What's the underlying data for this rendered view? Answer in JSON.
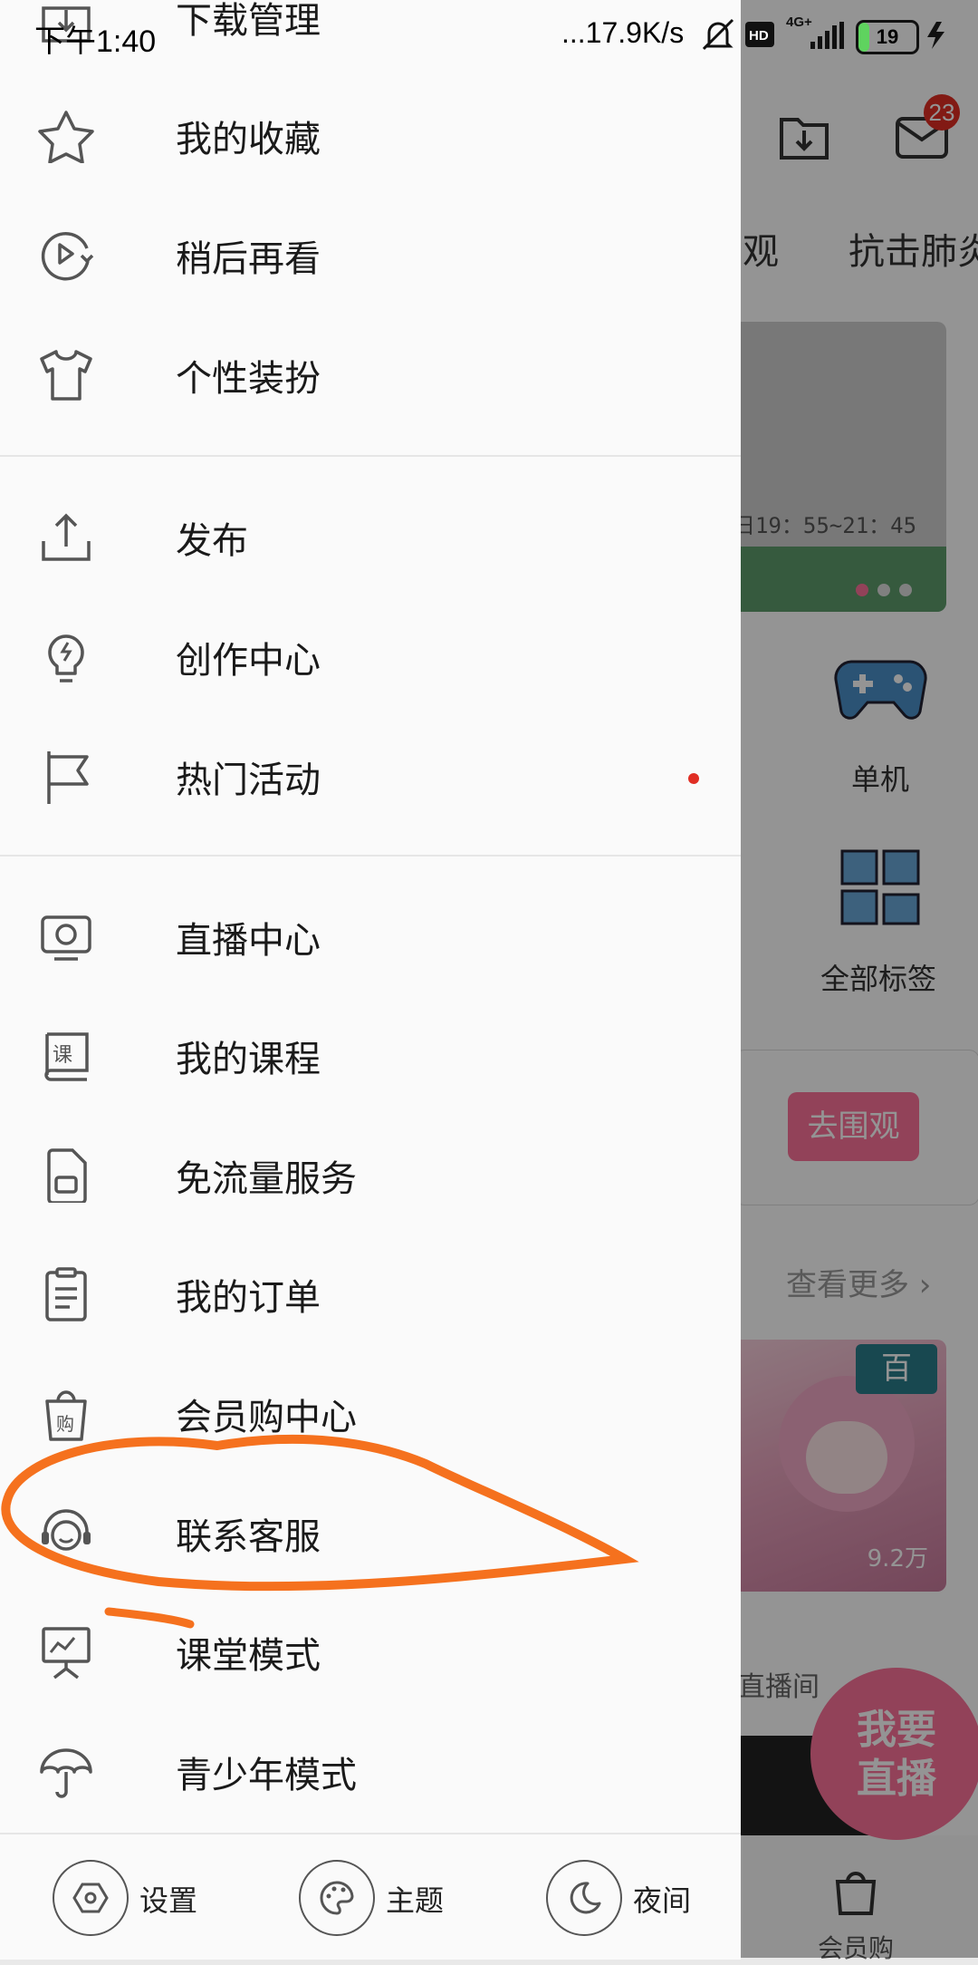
{
  "status_bar": {
    "time": "下午1:40",
    "speed": "...17.9K/s",
    "network": "4G+",
    "battery": "19"
  },
  "background": {
    "mail_badge": "23",
    "tabs": [
      "观",
      "抗击肺炎"
    ],
    "banner_text": "日19：55~21：45",
    "categories": [
      "单机",
      "全部标签"
    ],
    "card_button": "去围观",
    "see_more": "查看更多",
    "thumb_tag": "百",
    "thumb_views": "9.2万",
    "live_room": "直播间",
    "float_button": [
      "我要",
      "直播"
    ],
    "shop_label": "会员购"
  },
  "drawer": {
    "items_top": [
      {
        "label": "下载管理",
        "icon": "download-box-icon"
      },
      {
        "label": "我的收藏",
        "icon": "star-icon"
      },
      {
        "label": "稍后再看",
        "icon": "watch-later-icon"
      },
      {
        "label": "个性装扮",
        "icon": "tshirt-icon"
      }
    ],
    "items_mid": [
      {
        "label": "发布",
        "icon": "upload-icon"
      },
      {
        "label": "创作中心",
        "icon": "lightbulb-icon"
      },
      {
        "label": "热门活动",
        "icon": "flag-icon"
      }
    ],
    "items_bottom": [
      {
        "label": "直播中心",
        "icon": "live-tv-icon"
      },
      {
        "label": "我的课程",
        "icon": "course-book-icon"
      },
      {
        "label": "免流量服务",
        "icon": "sim-card-icon"
      },
      {
        "label": "我的订单",
        "icon": "order-clipboard-icon"
      },
      {
        "label": "会员购中心",
        "icon": "shopping-bag-icon"
      },
      {
        "label": "联系客服",
        "icon": "headset-icon"
      },
      {
        "label": "课堂模式",
        "icon": "classroom-board-icon"
      },
      {
        "label": "青少年模式",
        "icon": "umbrella-icon"
      }
    ],
    "footer": [
      {
        "label": "设置",
        "icon": "settings-hex-icon"
      },
      {
        "label": "主题",
        "icon": "palette-icon"
      },
      {
        "label": "夜间",
        "icon": "moon-icon"
      }
    ]
  },
  "annotation": {
    "color": "#f5711e",
    "shape": "hand-drawn circle around 联系客服"
  }
}
